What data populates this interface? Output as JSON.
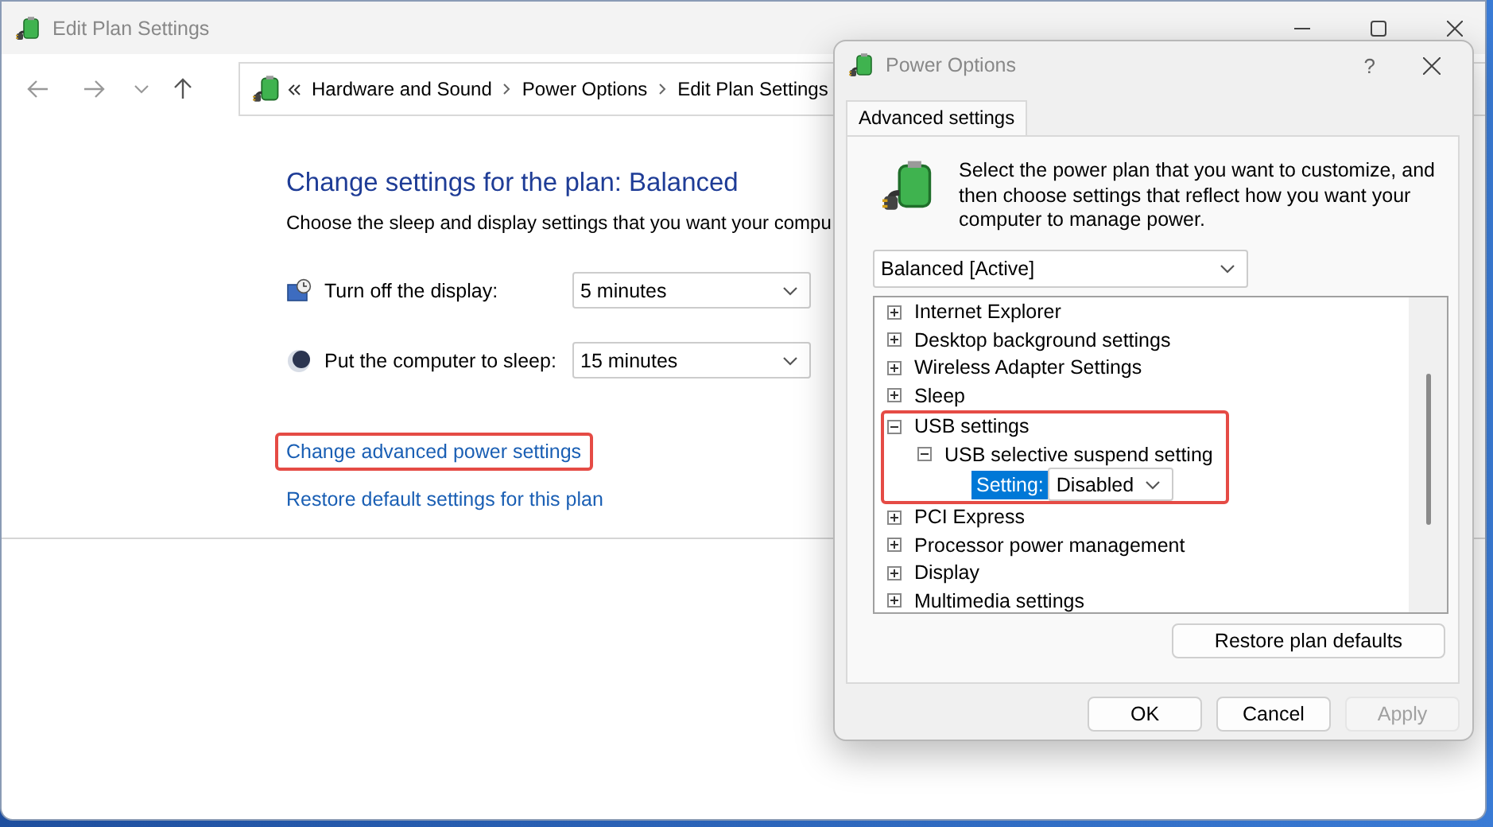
{
  "main_window": {
    "title": "Edit Plan Settings",
    "breadcrumb": [
      "Hardware and Sound",
      "Power Options",
      "Edit Plan Settings"
    ],
    "heading": "Change settings for the plan: Balanced",
    "description": "Choose the sleep and display settings that you want your compu",
    "settings": [
      {
        "kind": "display",
        "label": "Turn off the display:",
        "value": "5 minutes"
      },
      {
        "kind": "sleep",
        "label": "Put the computer to sleep:",
        "value": "15 minutes"
      }
    ],
    "links": [
      {
        "text": "Change advanced power settings",
        "highlighted": true
      },
      {
        "text": "Restore default settings for this plan",
        "highlighted": false
      }
    ]
  },
  "dialog": {
    "title": "Power Options",
    "help": "?",
    "tabs": [
      {
        "label": "Advanced settings",
        "selected": true
      }
    ],
    "intro": "Select the power plan that you want to customize, and then choose settings that reflect how you want your computer to manage power.",
    "plan": "Balanced [Active]",
    "tree": [
      {
        "label": "Internet Explorer",
        "expanded": false,
        "highlighted": false
      },
      {
        "label": "Desktop background settings",
        "expanded": false,
        "highlighted": false
      },
      {
        "label": "Wireless Adapter Settings",
        "expanded": false,
        "highlighted": false
      },
      {
        "label": "Sleep",
        "expanded": false,
        "highlighted": false
      },
      {
        "label": "USB settings",
        "expanded": true,
        "highlighted": true,
        "children": [
          {
            "label": "USB selective suspend setting",
            "expanded": true,
            "highlighted": false,
            "children": [
              {
                "kind": "setting",
                "label": "Setting:",
                "value": "Disabled",
                "selected": true
              }
            ]
          }
        ]
      },
      {
        "label": "PCI Express",
        "expanded": false,
        "highlighted": false
      },
      {
        "label": "Processor power management",
        "expanded": false,
        "highlighted": false
      },
      {
        "label": "Display",
        "expanded": false,
        "highlighted": false
      },
      {
        "label": "Multimedia settings",
        "expanded": false,
        "highlighted": false
      }
    ],
    "restore_button": "Restore plan defaults",
    "buttons": [
      {
        "label": "OK",
        "disabled": false
      },
      {
        "label": "Cancel",
        "disabled": false
      },
      {
        "label": "Apply",
        "disabled": true
      }
    ]
  }
}
